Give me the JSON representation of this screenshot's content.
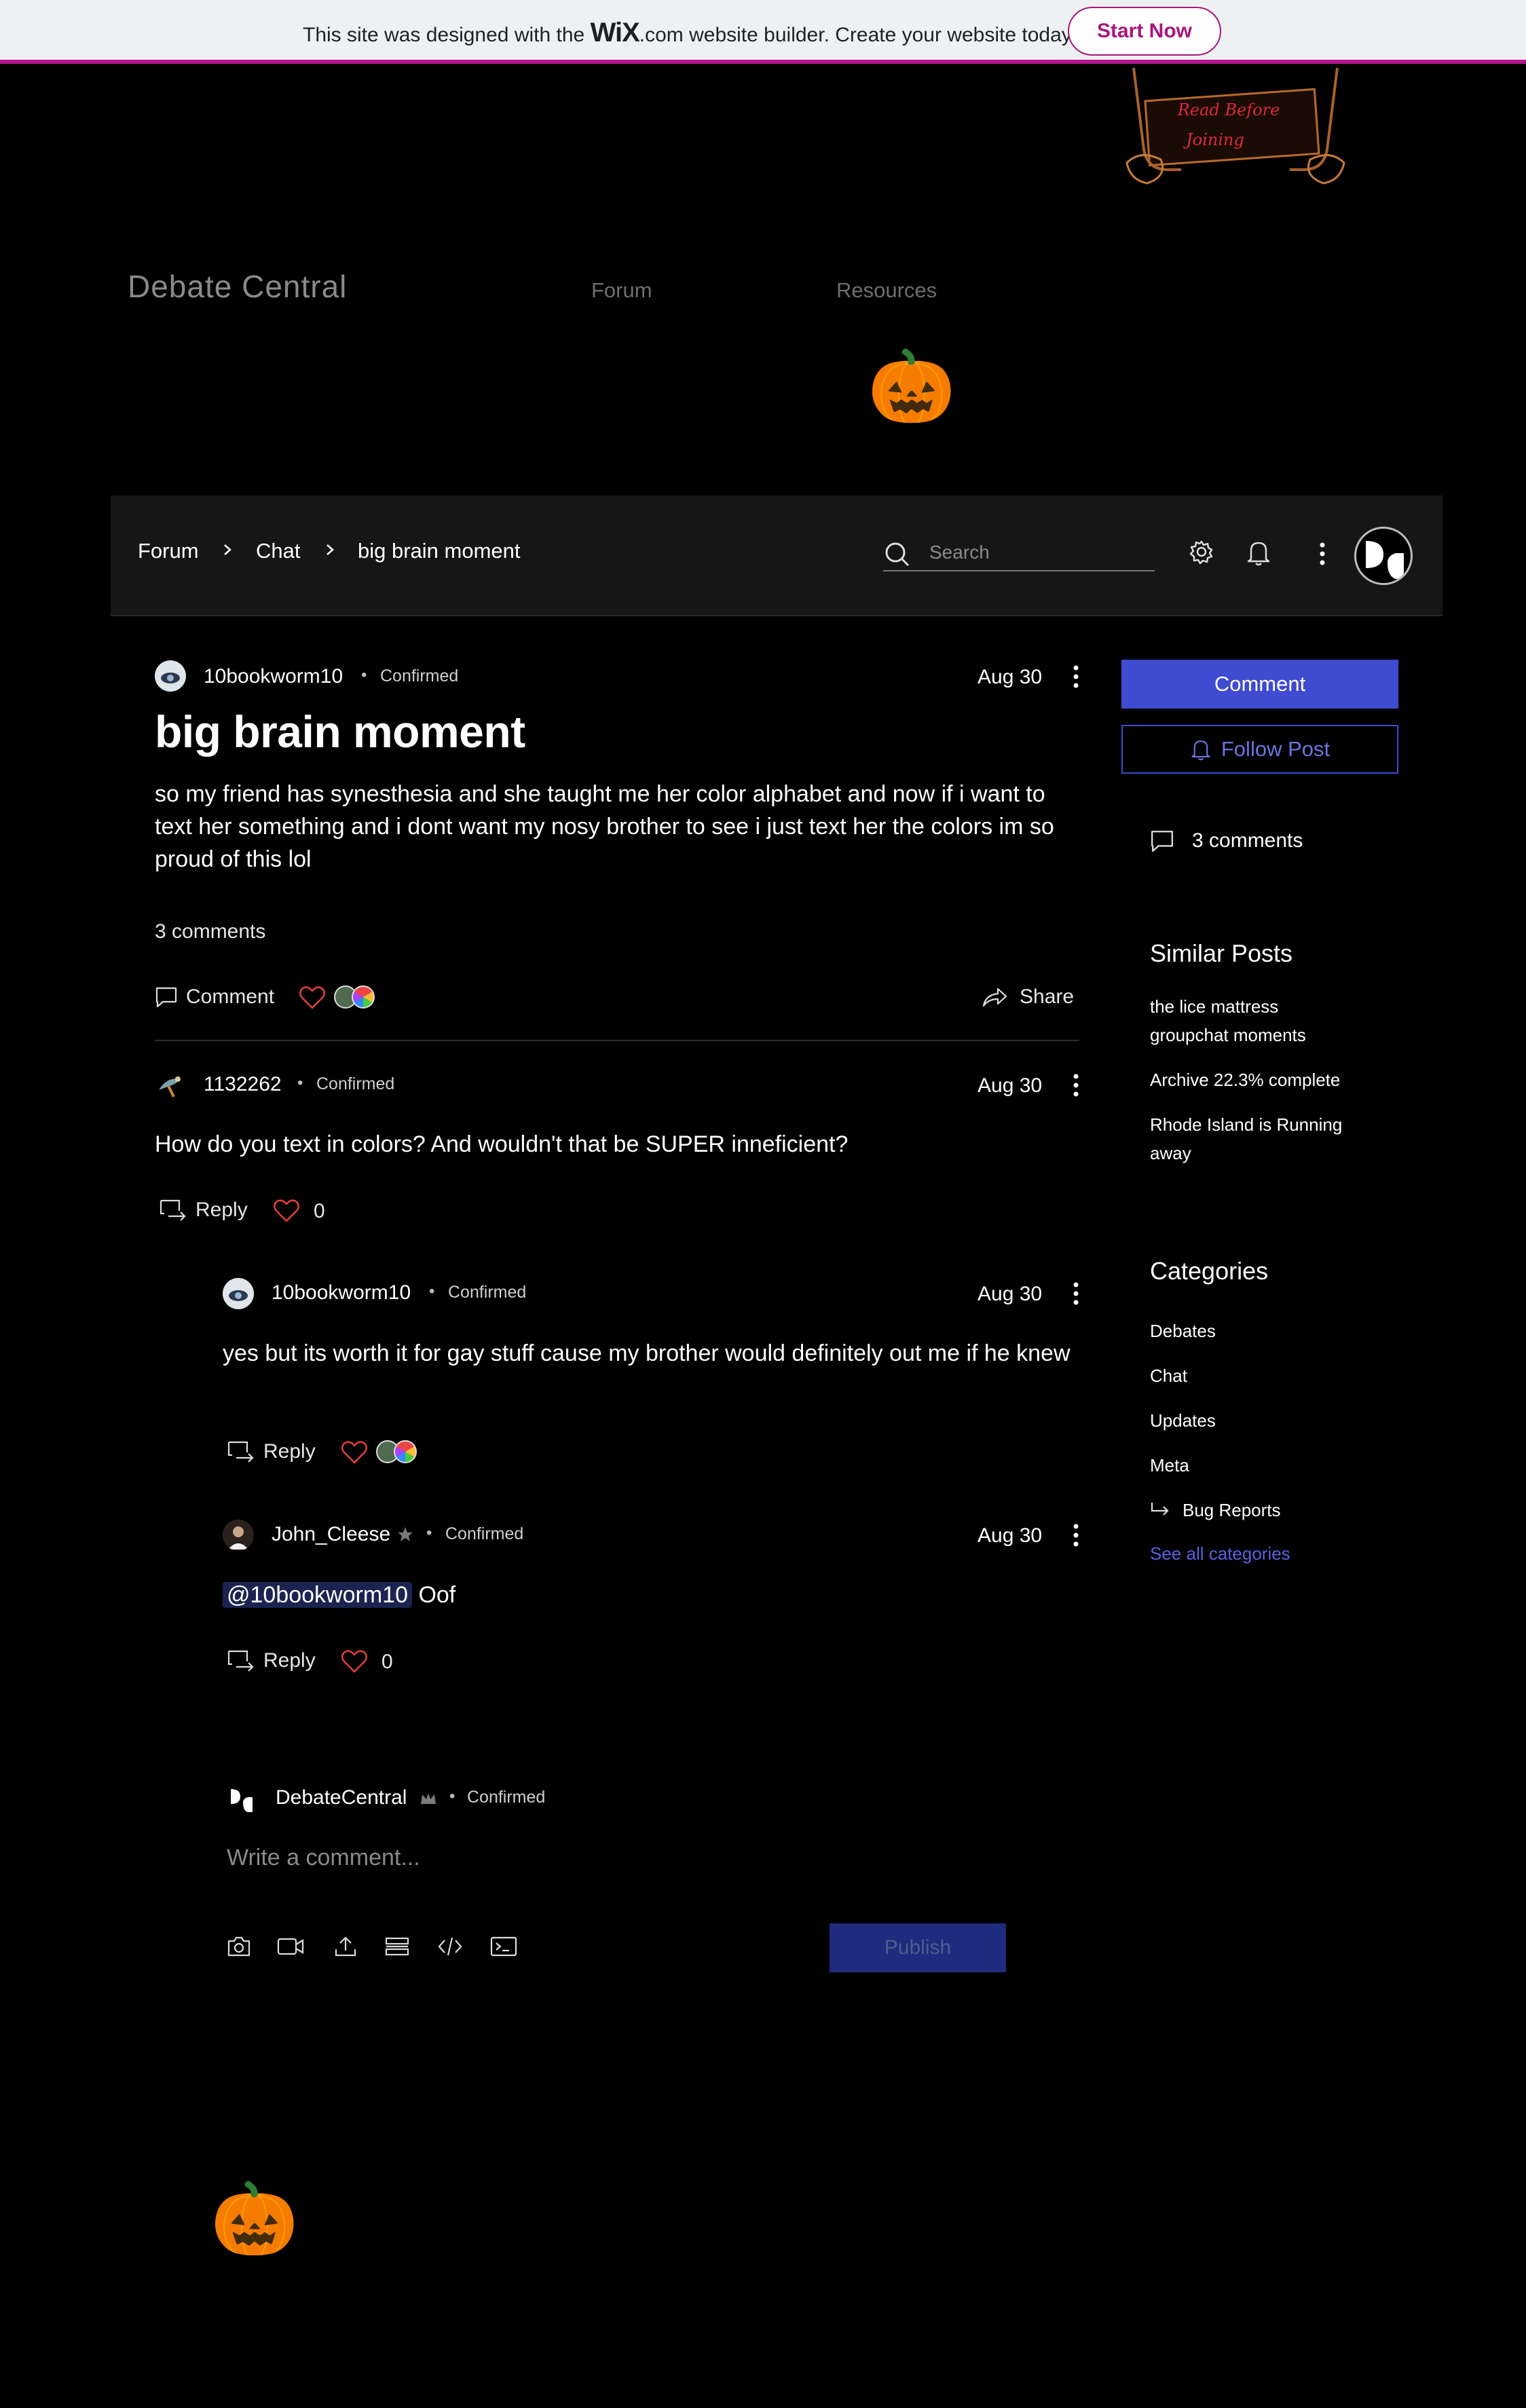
{
  "wix_banner": {
    "text_before": "This site was designed with the",
    "brand": "WiX",
    "text_after": ".com website builder. Create your website today.",
    "cta": "Start Now"
  },
  "site": {
    "title": "Debate Central",
    "nav": [
      "Forum",
      "Resources"
    ],
    "logo_text_line1": "Read Before",
    "logo_text_line2": "Joining",
    "pumpkin_icon": "🎃"
  },
  "toolbar": {
    "breadcrumb": [
      "Forum",
      "Chat",
      "big brain moment"
    ],
    "search_placeholder": "Search"
  },
  "post": {
    "author": "10bookworm10",
    "badge": "Confirmed",
    "date": "Aug 30",
    "title": "big brain moment",
    "body": "so my friend has synesthesia and she taught me her color alphabet and now if i want to text her something and i dont want my nosy brother to see i just text her the colors im so proud of this lol",
    "comments_count": "3 comments",
    "comment_label": "Comment",
    "share_label": "Share"
  },
  "comments": [
    {
      "author": "1132262",
      "badge": "Confirmed",
      "date": "Aug 30",
      "text": "How do you text in colors? And wouldn't that be SUPER inneficient?",
      "reply_label": "Reply",
      "likes": "0"
    },
    {
      "author": "10bookworm10",
      "badge": "Confirmed",
      "date": "Aug 30",
      "text": "yes but its worth it for gay stuff cause my brother would definitely out me if he knew",
      "reply_label": "Reply"
    },
    {
      "author": "John_Cleese",
      "badge": "Confirmed",
      "date": "Aug 30",
      "mention": "@10bookworm10",
      "text": " Oof",
      "reply_label": "Reply",
      "likes": "0"
    }
  ],
  "composer": {
    "author": "DebateCentral",
    "badge": "Confirmed",
    "placeholder": "Write a comment...",
    "publish_label": "Publish"
  },
  "sidebar": {
    "comment_button": "Comment",
    "follow_button": "Follow Post",
    "comments_count": "3 comments",
    "similar_heading": "Similar Posts",
    "similar_posts": [
      "the lice mattress groupchat moments",
      "Archive 22.3% complete",
      "Rhode Island is Running away"
    ],
    "categories_heading": "Categories",
    "categories": [
      "Debates",
      "Chat",
      "Updates",
      "Meta"
    ],
    "subcategory": "Bug Reports",
    "see_all": "See all categories"
  },
  "colors": {
    "accent": "#3f4bd0",
    "wix_brand": "#a8157e",
    "like_heart": "#e0413a"
  }
}
